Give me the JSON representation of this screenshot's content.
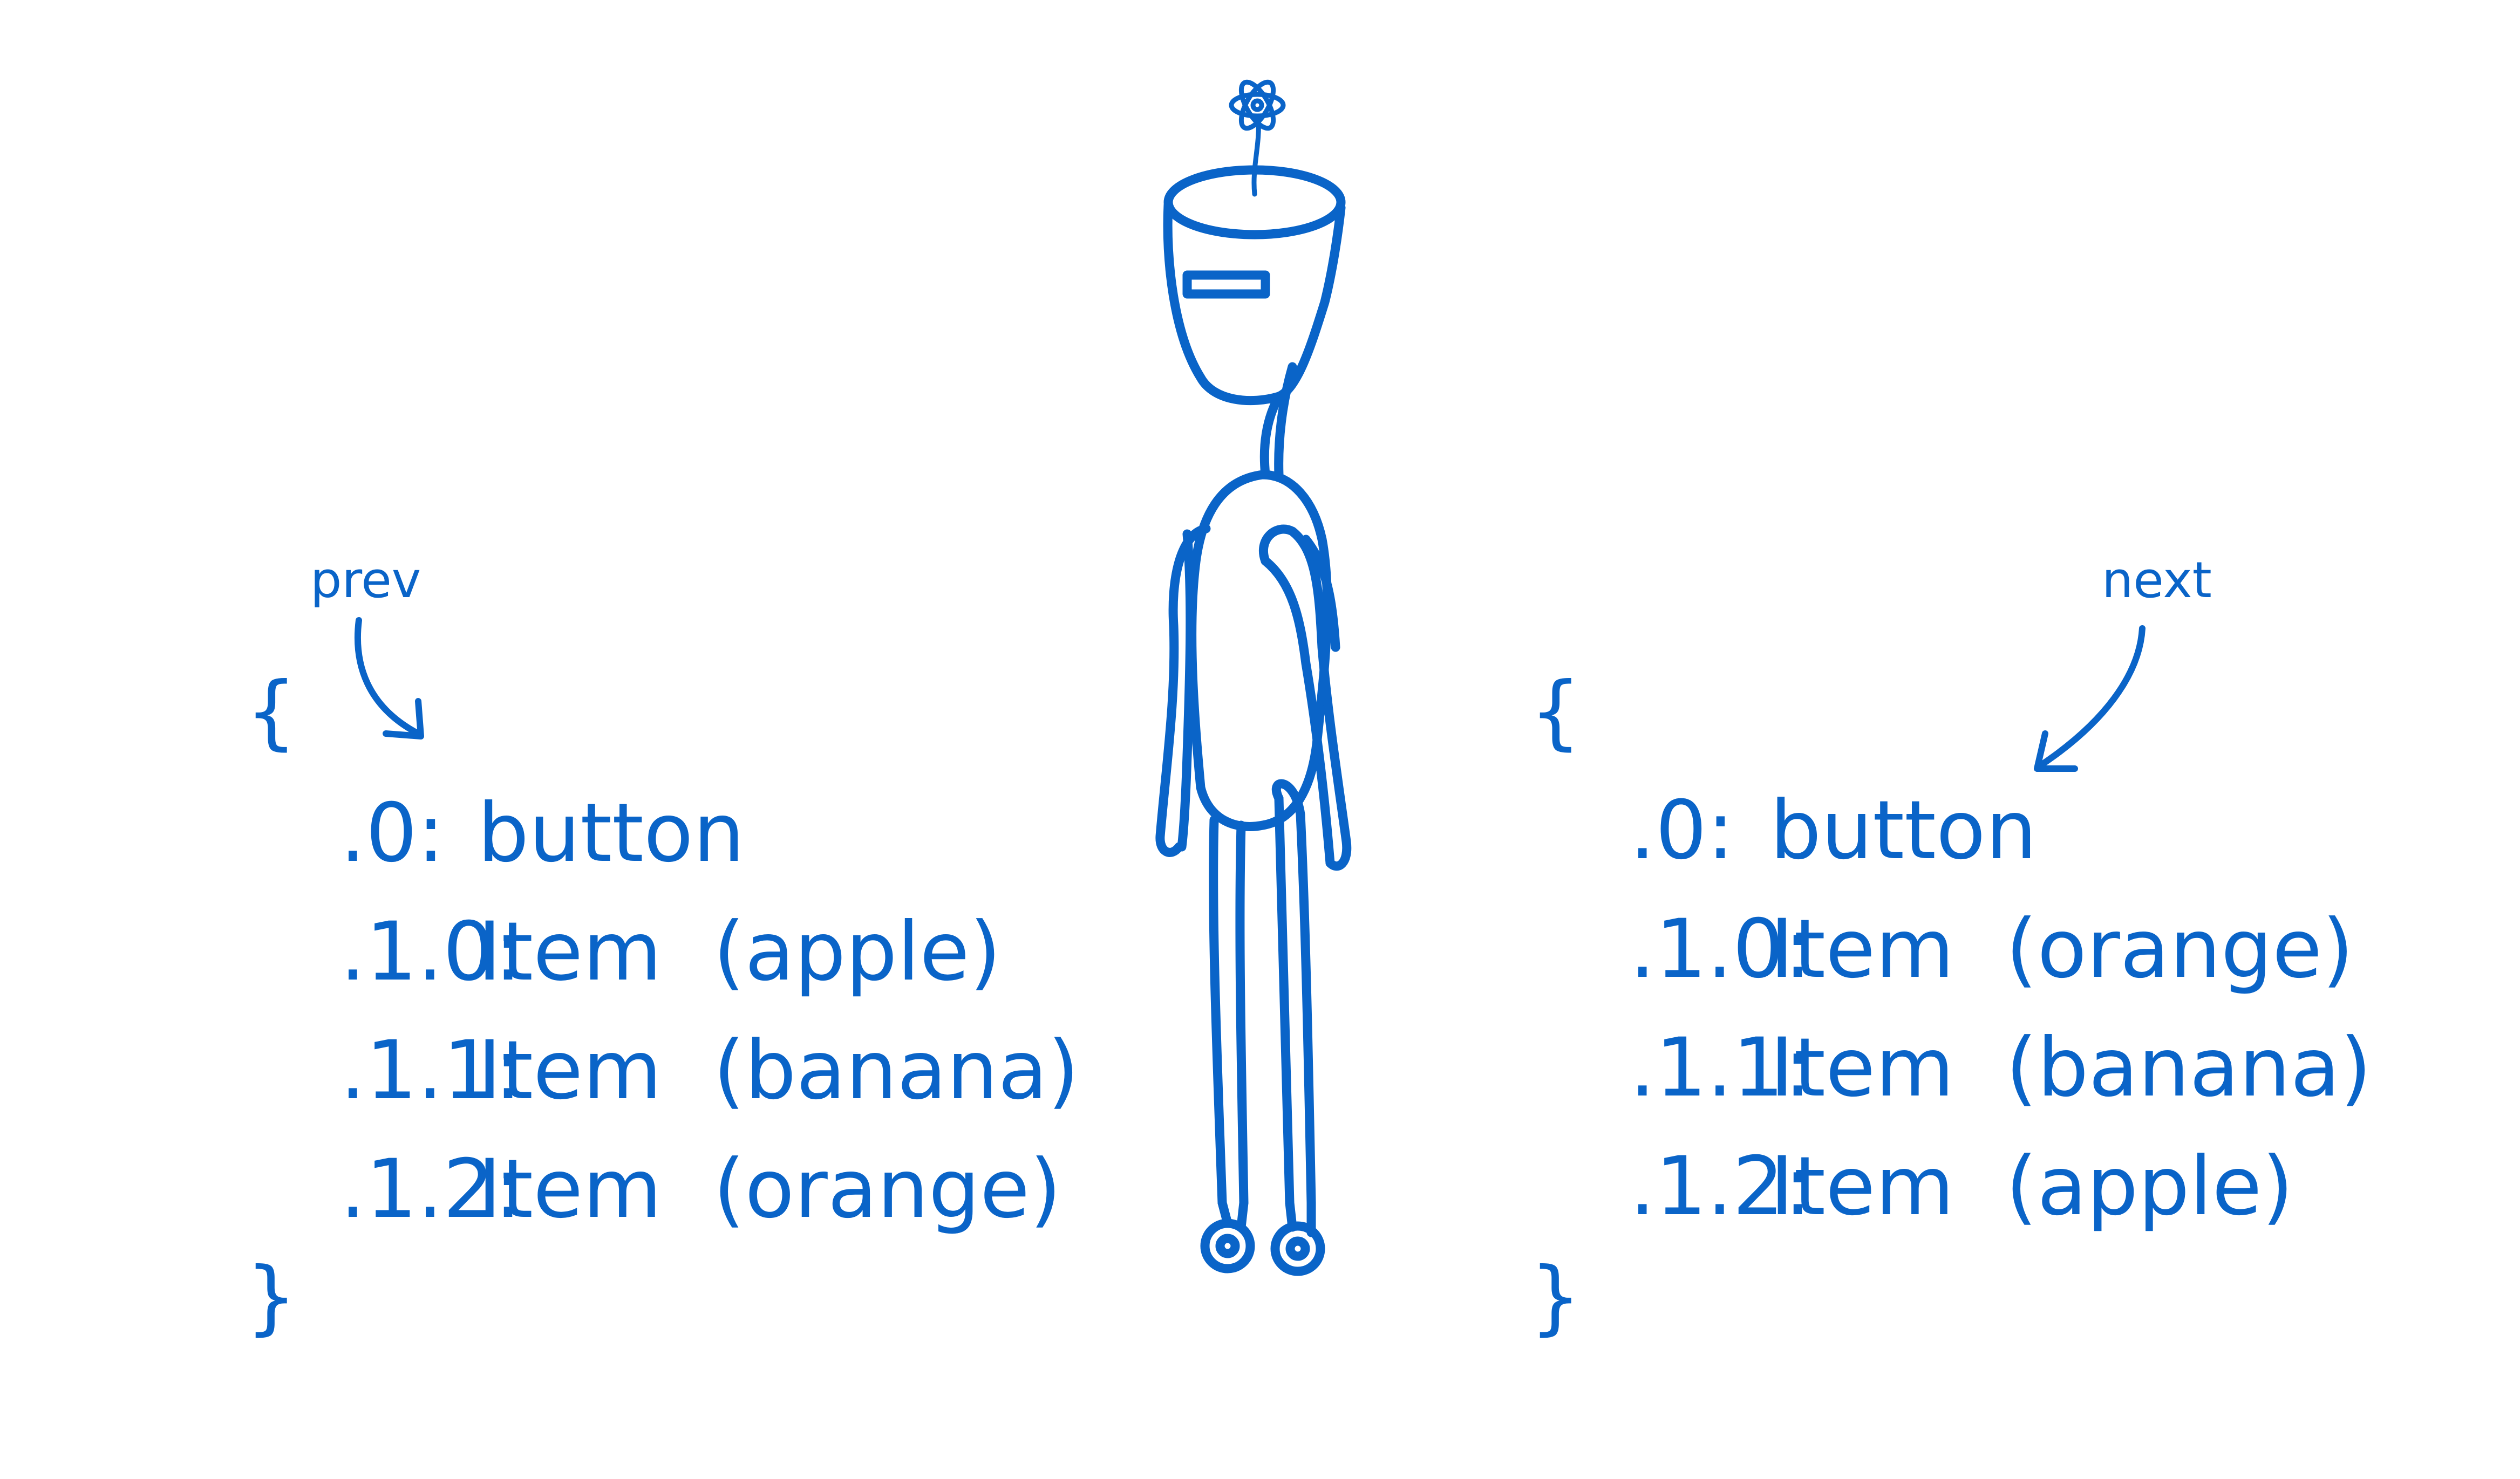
{
  "prev": {
    "label": "prev",
    "open_brace": "{",
    "close_brace": "}",
    "entries": [
      {
        "key": ".0:",
        "value": "button"
      },
      {
        "key": ".1.0:",
        "value": "Item  (apple)"
      },
      {
        "key": ".1.1:",
        "value": "Item  (banana)"
      },
      {
        "key": ".1.2:",
        "value": "Item  (orange)"
      }
    ]
  },
  "next": {
    "label": "next",
    "open_brace": "{",
    "close_brace": "}",
    "entries": [
      {
        "key": ".0:",
        "value": "button"
      },
      {
        "key": ".1.0:",
        "value": "Item  (orange)"
      },
      {
        "key": ".1.1:",
        "value": "Item  (banana)"
      },
      {
        "key": ".1.2:",
        "value": "Item  (apple)"
      }
    ]
  },
  "colors": {
    "ink": "#0a64c8",
    "background": "#ffffff"
  }
}
